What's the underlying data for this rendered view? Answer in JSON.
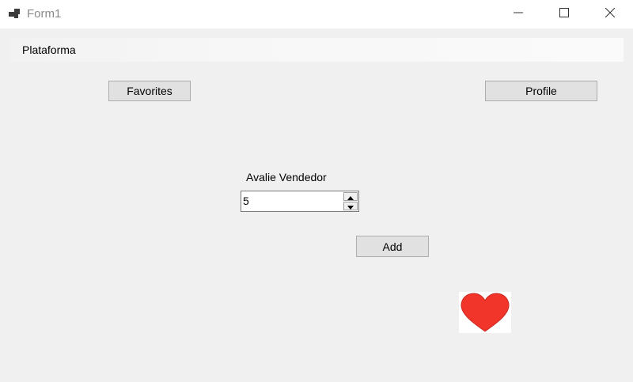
{
  "window": {
    "title": "Form1",
    "icons": {
      "app": "app-form-icon",
      "minimize": "minimize-icon",
      "maximize": "maximize-icon",
      "close": "close-icon"
    }
  },
  "menu": {
    "items": [
      {
        "label": "Plataforma"
      }
    ]
  },
  "buttons": {
    "favorites": "Favorites",
    "profile": "Profile",
    "add": "Add"
  },
  "rating": {
    "label": "Avalie Vendedor",
    "value": "5"
  },
  "picture": {
    "icon": "heart-icon",
    "color": "#f1352b"
  },
  "colors": {
    "form_background": "#f0f0f0",
    "button_face": "#e1e1e1",
    "button_border": "#adadad",
    "heart": "#f1352b"
  }
}
